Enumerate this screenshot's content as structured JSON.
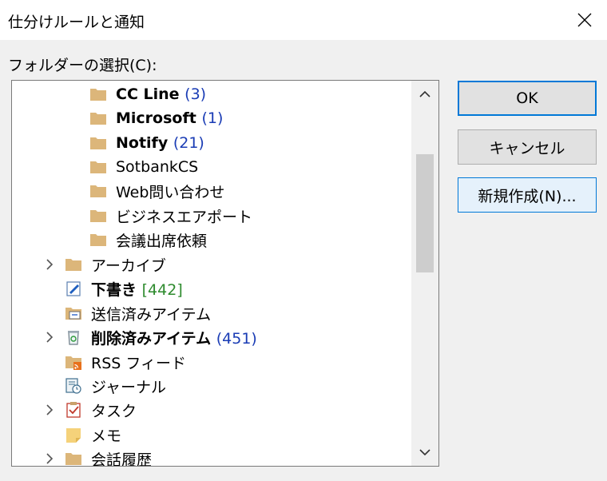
{
  "window": {
    "title": "仕分けルールと通知"
  },
  "folder_label": "フォルダーの選択(C):",
  "tree": [
    {
      "label": "CC Line",
      "count": "(3)",
      "bold": true
    },
    {
      "label": "Microsoft",
      "count": "(1)",
      "bold": true
    },
    {
      "label": "Notify",
      "count": "(21)",
      "bold": true
    },
    {
      "label": "SotbankCS"
    },
    {
      "label": "Web問い合わせ"
    },
    {
      "label": "ビジネスエアポート"
    },
    {
      "label": "会議出席依頼"
    },
    {
      "label": "アーカイブ"
    },
    {
      "label": "下書き",
      "count": "[442]",
      "bold": true
    },
    {
      "label": "送信済みアイテム"
    },
    {
      "label": "削除済みアイテム",
      "count": "(451)",
      "bold": true
    },
    {
      "label": "RSS フィード"
    },
    {
      "label": "ジャーナル"
    },
    {
      "label": "タスク"
    },
    {
      "label": "メモ"
    },
    {
      "label": "会話履歴"
    }
  ],
  "buttons": {
    "ok": "OK",
    "cancel": "キャンセル",
    "new": "新規作成(N)..."
  },
  "icons": {
    "folder": "folder-icon",
    "drafts": "drafts-icon",
    "sent": "sent-items-icon",
    "deleted": "recycle-bin-icon",
    "rss": "rss-feed-icon",
    "journal": "journal-icon",
    "tasks": "tasks-icon",
    "notes": "notes-icon"
  },
  "colors": {
    "count_blue": "#1a3cb5",
    "count_green": "#2e8b2e",
    "accent": "#0078d7",
    "folder": "#dcb67a"
  }
}
